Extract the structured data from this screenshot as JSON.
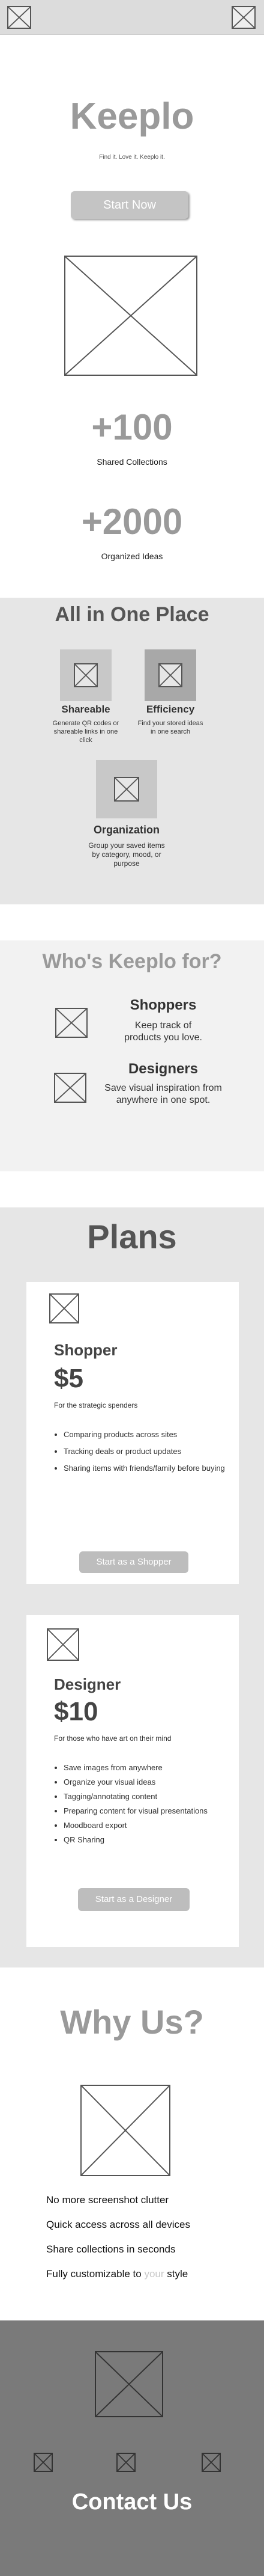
{
  "hero": {
    "brand": "Keeplo",
    "tagline": "Find it. Love it. Keeplo it.",
    "cta_label": "Start Now"
  },
  "stats": [
    {
      "value": "+100",
      "label": "Shared Collections"
    },
    {
      "value": "+2000",
      "label": "Organized Ideas"
    }
  ],
  "features": {
    "title": "All in One Place",
    "items": [
      {
        "title": "Shareable",
        "desc": "Generate QR codes or shareable links in one click"
      },
      {
        "title": "Efficiency",
        "desc": "Find your stored ideas in one search"
      },
      {
        "title": "Organization",
        "desc": "Group your saved items by category, mood, or purpose"
      }
    ]
  },
  "audience": {
    "title": "Who's Keeplo for?",
    "items": [
      {
        "title": "Shoppers",
        "desc": "Keep track of products you love."
      },
      {
        "title": "Designers",
        "desc": "Save visual inspiration from anywhere in one spot."
      }
    ]
  },
  "plans": {
    "title": "Plans",
    "items": [
      {
        "name": "Shopper",
        "price": "$5",
        "subtitle": "For the strategic spenders",
        "features": [
          "Comparing products across sites",
          "Tracking deals or product updates",
          "Sharing items with friends/family before buying"
        ],
        "cta": "Start as a Shopper"
      },
      {
        "name": "Designer",
        "price": "$10",
        "subtitle": "For those who have art on their mind",
        "features": [
          "Save images from anywhere",
          "Organize your visual ideas",
          "Tagging/annotating content",
          "Preparing content for visual presentations",
          "Moodboard export",
          "QR Sharing"
        ],
        "cta": "Start as a Designer"
      }
    ]
  },
  "why": {
    "title": "Why Us?",
    "points": [
      "No more screenshot clutter",
      "Quick access across all devices",
      "Share collections in seconds"
    ],
    "last_point_prefix": "Fully customizable to ",
    "last_point_highlight": "your",
    "last_point_suffix": " style"
  },
  "footer": {
    "title": "Contact Us"
  }
}
